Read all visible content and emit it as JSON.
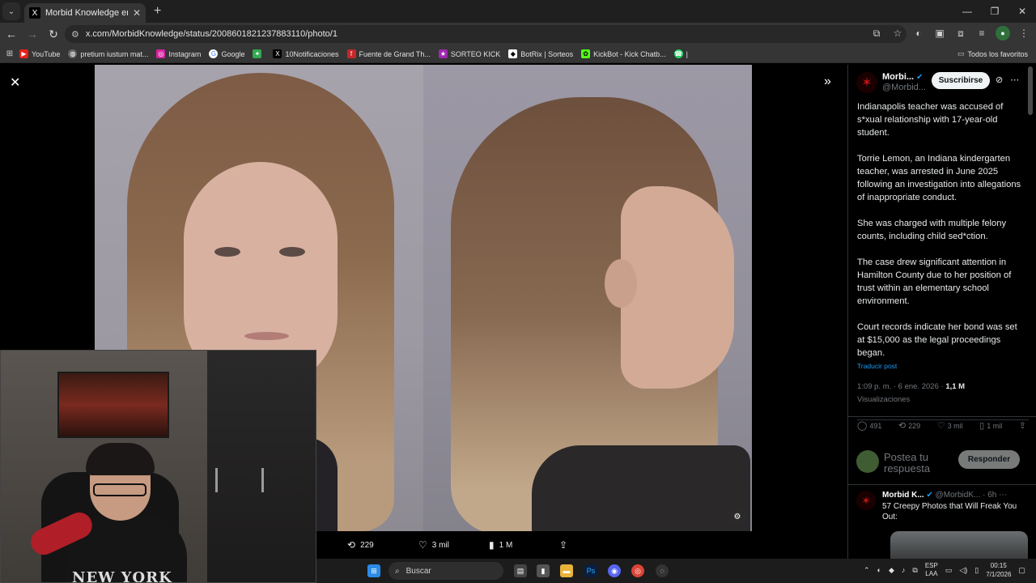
{
  "browser": {
    "tab_title": "Morbid Knowledge en X: \"Indi",
    "tab_favicon": "X",
    "url": "x.com/MorbidKnowledge/status/2008601821237883110/photo/1",
    "bookmarks": [
      {
        "label": "YouTube",
        "icon": "youtube-icon",
        "color": "#e62117"
      },
      {
        "label": "pretium iustum mat...",
        "icon": "globe-icon",
        "color": "#666666"
      },
      {
        "label": "Instagram",
        "icon": "instagram-icon",
        "color": "#d6249f"
      },
      {
        "label": "Google",
        "icon": "google-icon",
        "color": "#4285f4"
      },
      {
        "label": "",
        "icon": "colorful-icon",
        "color": "#34a853"
      },
      {
        "label": "10Notificaciones",
        "icon": "x-icon",
        "color": "#000000"
      },
      {
        "label": "Fuente de Grand Th...",
        "icon": "font-icon",
        "color": "#c62828"
      },
      {
        "label": "SORTEO KICK",
        "icon": "kick-icon",
        "color": "#9c27b0"
      },
      {
        "label": "BotRix | Sorteos",
        "icon": "botrix-icon",
        "color": "#ffffff"
      },
      {
        "label": "KickBot - Kick Chatb...",
        "icon": "kickbot-icon",
        "color": "#53fc18"
      },
      {
        "label": "|",
        "icon": "whatsapp-icon",
        "color": "#25d366"
      }
    ],
    "all_bookmarks": "Todos los favoritos"
  },
  "viewer": {
    "actions": {
      "retweets": "229",
      "likes": "3 mil",
      "views": "1 M"
    }
  },
  "tweet": {
    "author_name": "Morbi...",
    "author_handle": "@Morbid...",
    "subscribe_label": "Suscribirse",
    "paragraphs": [
      "Indianapolis teacher was accused of s*xual relationship with 17-year-old student.",
      "Torrie Lemon, an Indiana kindergarten teacher, was arrested in June 2025 following an investigation into allegations of inappropriate conduct.",
      "She was charged with multiple felony counts, including child sed*ction.",
      "The case drew significant attention in Hamilton County due to her position of trust within an elementary school environment.",
      "Court records indicate her bond was set at $15,000 as the legal proceedings began."
    ],
    "translate": "Traducir post",
    "timestamp": "1:09 p. m. · 6 ene. 2026 · ",
    "views_count": "1,1 M",
    "views_label": "Visualizaciones",
    "stats": {
      "replies": "491",
      "retweets": "229",
      "likes": "3 mil",
      "bookmarks": "1 mil"
    },
    "reply_placeholder": "Postea tu respuesta",
    "reply_button": "Responder"
  },
  "next_post": {
    "author": "Morbid K...",
    "handle": "@MorbidK...",
    "time": "· 6h",
    "text": "57 Creepy Photos that Will Freak You Out:"
  },
  "taskbar": {
    "search_placeholder": "Buscar",
    "lang_top": "ESP",
    "lang_bottom": "LAA",
    "time": "00:15",
    "date": "7/1/2026"
  },
  "webcam": {
    "hoodie_text": "NEW YORK"
  }
}
